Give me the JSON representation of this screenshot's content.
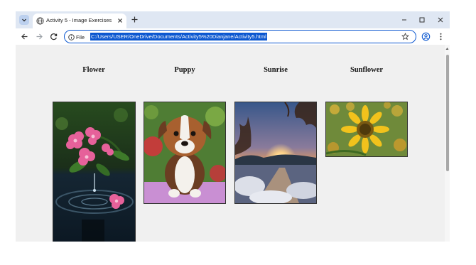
{
  "browser": {
    "tab_title": "Activity 5 - Image Exercises",
    "site_info_label": "File",
    "url": "C:/Users/USER/OneDrive/Documents/Activity5%20Dianjane/Activity5.html"
  },
  "gallery": {
    "items": [
      {
        "caption": "Flower"
      },
      {
        "caption": "Puppy"
      },
      {
        "caption": "Sunrise"
      },
      {
        "caption": "Sunflower"
      }
    ]
  }
}
